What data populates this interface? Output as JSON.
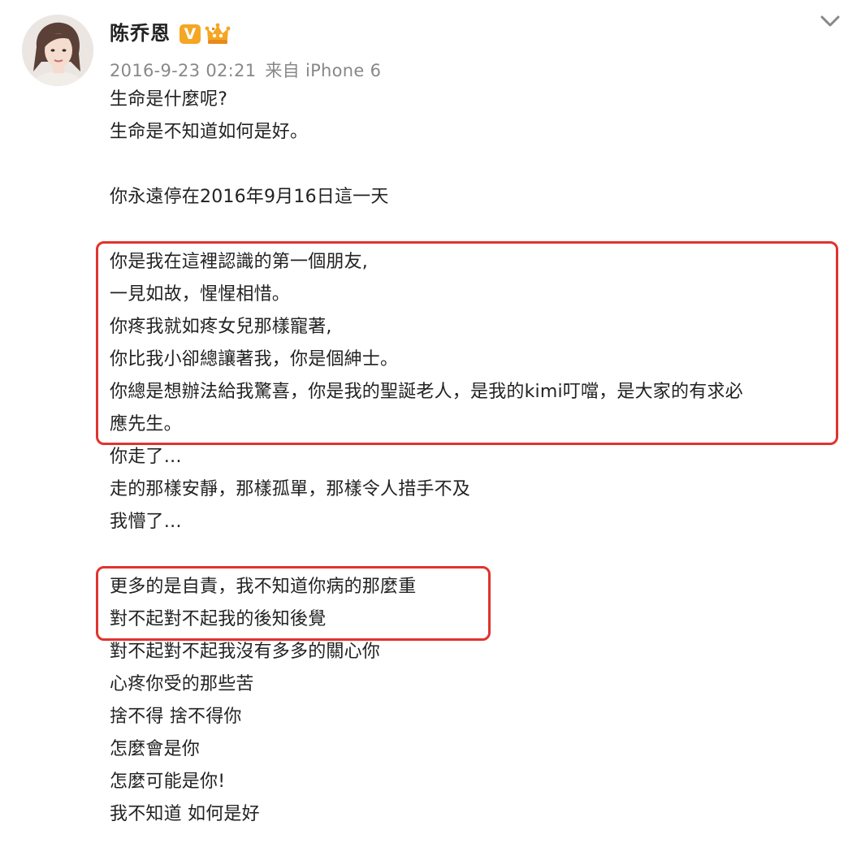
{
  "post": {
    "author": "陈乔恩",
    "verified_badge": "V",
    "timestamp": "2016-9-23 02:21",
    "source_prefix": "来自",
    "source": "iPhone 6",
    "icons": [
      "avatar",
      "verified-v-icon",
      "member-crown-icon",
      "chevron-down-icon"
    ],
    "colors": {
      "badge": "#f5a623",
      "highlight_border": "#e0332e",
      "meta_text": "#888888"
    },
    "lines": [
      "生命是什麼呢?",
      "生命是不知道如何是好。",
      "",
      "你永遠停在2016年9月16日這一天",
      "",
      "你是我在這裡認識的第一個朋友,",
      "一見如故，惺惺相惜。",
      "你疼我就如疼女兒那樣寵著,",
      "你比我小卻總讓著我，你是個紳士。",
      "你總是想辦法給我驚喜，你是我的聖誕老人，是我的kimi叮噹，是大家的有求必",
      "應先生。",
      "你走了…",
      "走的那樣安靜，那樣孤單，那樣令人措手不及",
      "我懵了…",
      "",
      "更多的是自責，我不知道你病的那麼重",
      "對不起對不起我的後知後覺",
      "對不起對不起我沒有多多的關心你",
      "心疼你受的那些苦",
      "捨不得 捨不得你",
      "怎麼會是你",
      "怎麼可能是你!",
      "我不知道 如何是好"
    ]
  }
}
